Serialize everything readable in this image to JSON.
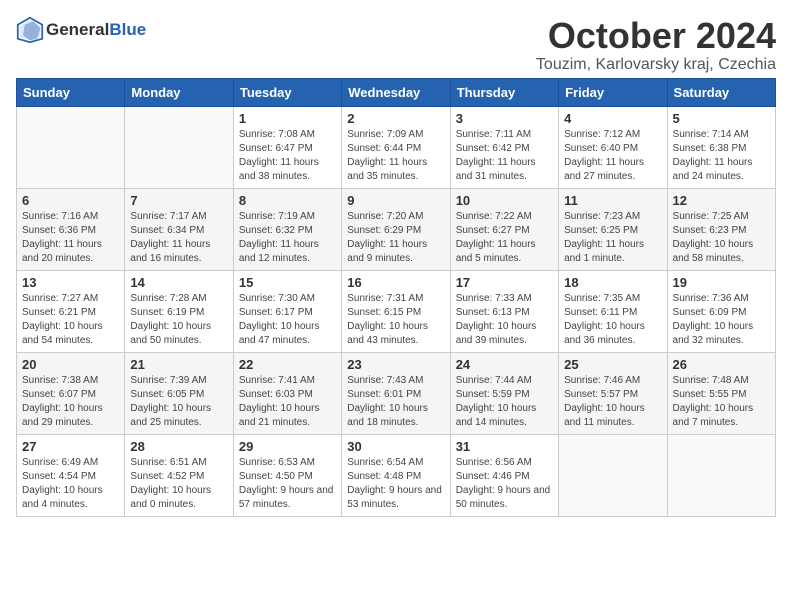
{
  "header": {
    "logo_general": "General",
    "logo_blue": "Blue",
    "month": "October 2024",
    "location": "Touzim, Karlovarsky kraj, Czechia"
  },
  "weekdays": [
    "Sunday",
    "Monday",
    "Tuesday",
    "Wednesday",
    "Thursday",
    "Friday",
    "Saturday"
  ],
  "weeks": [
    [
      {
        "day": "",
        "info": ""
      },
      {
        "day": "",
        "info": ""
      },
      {
        "day": "1",
        "info": "Sunrise: 7:08 AM\nSunset: 6:47 PM\nDaylight: 11 hours and 38 minutes."
      },
      {
        "day": "2",
        "info": "Sunrise: 7:09 AM\nSunset: 6:44 PM\nDaylight: 11 hours and 35 minutes."
      },
      {
        "day": "3",
        "info": "Sunrise: 7:11 AM\nSunset: 6:42 PM\nDaylight: 11 hours and 31 minutes."
      },
      {
        "day": "4",
        "info": "Sunrise: 7:12 AM\nSunset: 6:40 PM\nDaylight: 11 hours and 27 minutes."
      },
      {
        "day": "5",
        "info": "Sunrise: 7:14 AM\nSunset: 6:38 PM\nDaylight: 11 hours and 24 minutes."
      }
    ],
    [
      {
        "day": "6",
        "info": "Sunrise: 7:16 AM\nSunset: 6:36 PM\nDaylight: 11 hours and 20 minutes."
      },
      {
        "day": "7",
        "info": "Sunrise: 7:17 AM\nSunset: 6:34 PM\nDaylight: 11 hours and 16 minutes."
      },
      {
        "day": "8",
        "info": "Sunrise: 7:19 AM\nSunset: 6:32 PM\nDaylight: 11 hours and 12 minutes."
      },
      {
        "day": "9",
        "info": "Sunrise: 7:20 AM\nSunset: 6:29 PM\nDaylight: 11 hours and 9 minutes."
      },
      {
        "day": "10",
        "info": "Sunrise: 7:22 AM\nSunset: 6:27 PM\nDaylight: 11 hours and 5 minutes."
      },
      {
        "day": "11",
        "info": "Sunrise: 7:23 AM\nSunset: 6:25 PM\nDaylight: 11 hours and 1 minute."
      },
      {
        "day": "12",
        "info": "Sunrise: 7:25 AM\nSunset: 6:23 PM\nDaylight: 10 hours and 58 minutes."
      }
    ],
    [
      {
        "day": "13",
        "info": "Sunrise: 7:27 AM\nSunset: 6:21 PM\nDaylight: 10 hours and 54 minutes."
      },
      {
        "day": "14",
        "info": "Sunrise: 7:28 AM\nSunset: 6:19 PM\nDaylight: 10 hours and 50 minutes."
      },
      {
        "day": "15",
        "info": "Sunrise: 7:30 AM\nSunset: 6:17 PM\nDaylight: 10 hours and 47 minutes."
      },
      {
        "day": "16",
        "info": "Sunrise: 7:31 AM\nSunset: 6:15 PM\nDaylight: 10 hours and 43 minutes."
      },
      {
        "day": "17",
        "info": "Sunrise: 7:33 AM\nSunset: 6:13 PM\nDaylight: 10 hours and 39 minutes."
      },
      {
        "day": "18",
        "info": "Sunrise: 7:35 AM\nSunset: 6:11 PM\nDaylight: 10 hours and 36 minutes."
      },
      {
        "day": "19",
        "info": "Sunrise: 7:36 AM\nSunset: 6:09 PM\nDaylight: 10 hours and 32 minutes."
      }
    ],
    [
      {
        "day": "20",
        "info": "Sunrise: 7:38 AM\nSunset: 6:07 PM\nDaylight: 10 hours and 29 minutes."
      },
      {
        "day": "21",
        "info": "Sunrise: 7:39 AM\nSunset: 6:05 PM\nDaylight: 10 hours and 25 minutes."
      },
      {
        "day": "22",
        "info": "Sunrise: 7:41 AM\nSunset: 6:03 PM\nDaylight: 10 hours and 21 minutes."
      },
      {
        "day": "23",
        "info": "Sunrise: 7:43 AM\nSunset: 6:01 PM\nDaylight: 10 hours and 18 minutes."
      },
      {
        "day": "24",
        "info": "Sunrise: 7:44 AM\nSunset: 5:59 PM\nDaylight: 10 hours and 14 minutes."
      },
      {
        "day": "25",
        "info": "Sunrise: 7:46 AM\nSunset: 5:57 PM\nDaylight: 10 hours and 11 minutes."
      },
      {
        "day": "26",
        "info": "Sunrise: 7:48 AM\nSunset: 5:55 PM\nDaylight: 10 hours and 7 minutes."
      }
    ],
    [
      {
        "day": "27",
        "info": "Sunrise: 6:49 AM\nSunset: 4:54 PM\nDaylight: 10 hours and 4 minutes."
      },
      {
        "day": "28",
        "info": "Sunrise: 6:51 AM\nSunset: 4:52 PM\nDaylight: 10 hours and 0 minutes."
      },
      {
        "day": "29",
        "info": "Sunrise: 6:53 AM\nSunset: 4:50 PM\nDaylight: 9 hours and 57 minutes."
      },
      {
        "day": "30",
        "info": "Sunrise: 6:54 AM\nSunset: 4:48 PM\nDaylight: 9 hours and 53 minutes."
      },
      {
        "day": "31",
        "info": "Sunrise: 6:56 AM\nSunset: 4:46 PM\nDaylight: 9 hours and 50 minutes."
      },
      {
        "day": "",
        "info": ""
      },
      {
        "day": "",
        "info": ""
      }
    ]
  ]
}
